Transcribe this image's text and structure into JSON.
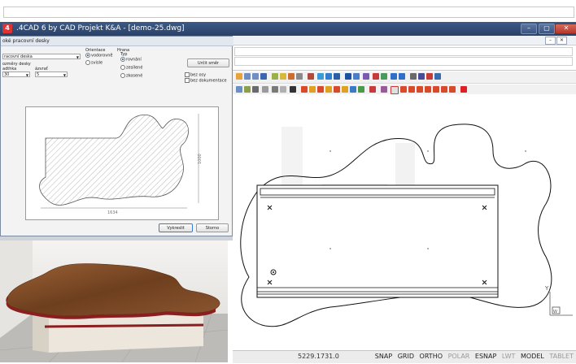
{
  "window": {
    "app_icon": "4cad-app-icon",
    "title": ".4CAD 6 by CAD Projekt K&A - [demo-25.dwg]",
    "controls": [
      "minimize",
      "maximize",
      "close"
    ],
    "mdi_controls": [
      "minimize",
      "close"
    ]
  },
  "dialog": {
    "title": "oké pracovní desky",
    "shape_combo": "racovní deska",
    "size_group": "ozměry desky",
    "width_label": "adthka",
    "width_value": "30",
    "rounding_label": "ázvrať",
    "rounding_value": "5",
    "orientation_label": "Orientace",
    "orientation_options": [
      "vodorovně",
      "svisle"
    ],
    "edge_label": "Hrana",
    "type_label": "Typ",
    "edge_type_options": [
      "rovnání",
      "zesílené",
      "zkosené"
    ],
    "determine_button": "Určit směr",
    "checkboxes": [
      "bez osy",
      "bez dokumentace"
    ],
    "dim_width": "1634",
    "dim_height": "1000",
    "ok_button": "Vykreslit",
    "cancel_button": "Storno"
  },
  "status": {
    "coordinates": "5229.1731.0",
    "toggles": [
      {
        "label": "SNAP",
        "on": true
      },
      {
        "label": "GRID",
        "on": true
      },
      {
        "label": "ORTHO",
        "on": true
      },
      {
        "label": "POLAR",
        "on": false
      },
      {
        "label": "ESNAP",
        "on": true
      },
      {
        "label": "LWT",
        "on": false
      },
      {
        "label": "MODEL",
        "on": true
      },
      {
        "label": "TABLET",
        "on": false
      }
    ]
  },
  "drawing": {
    "ucs_labels": {
      "y": "Y",
      "w": "W"
    }
  },
  "colors": {
    "title_bar": "#2f4a78",
    "wood_top": "#7a4a25",
    "edge_band": "#8b1f1f"
  }
}
